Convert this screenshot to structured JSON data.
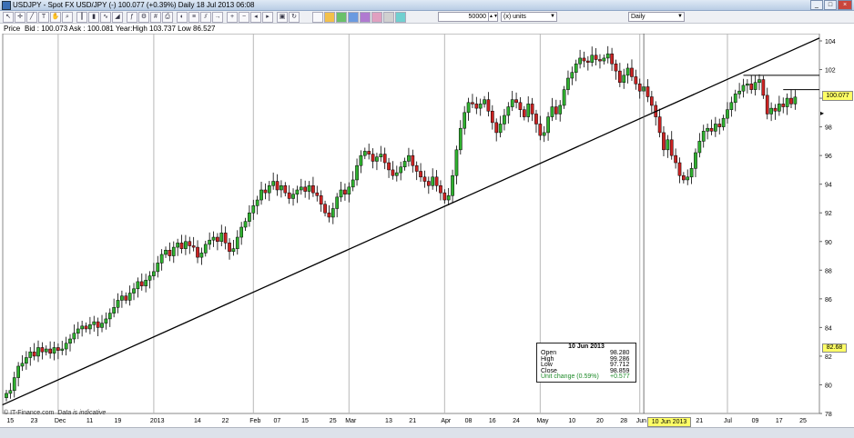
{
  "window": {
    "title": "USDJPY - Spot FX USD/JPY (-)   100.077 (+0.39%)   Daily   18 Jul 2013 06:08"
  },
  "toolbar": {
    "quantity": "50000",
    "units": "(x) units",
    "period": "Daily"
  },
  "infobar": {
    "label": "Price",
    "quote": "Bid : 100.073  Ask : 100.081  Year:High 103.737  Low 86.527"
  },
  "price_tag": "100.077",
  "price_tag2": "82.68",
  "cross_date": "10 Jun 2013",
  "credit": {
    "text": "© IT-Finance.com",
    "note": "Data is indicative"
  },
  "tooltip": {
    "date": "10 Jun 2013",
    "rows": [
      {
        "k": "Open",
        "v": "98.280"
      },
      {
        "k": "High",
        "v": "99.286"
      },
      {
        "k": "Low",
        "v": "97.712"
      },
      {
        "k": "Close",
        "v": "98.859"
      },
      {
        "k": "Unit change (0.59%)",
        "v": "+0.577"
      }
    ]
  },
  "colors": {
    "up": "#2fb12f",
    "down": "#cc2222",
    "grid": "#b8b8b8",
    "trend": "#000000"
  },
  "chart_data": {
    "type": "candlestick",
    "y_ticks": [
      78,
      80,
      82,
      84,
      86,
      88,
      90,
      92,
      94,
      96,
      98,
      100,
      102,
      104
    ],
    "ylim": [
      78,
      105
    ],
    "x_labels": [
      {
        "t": "15",
        "i": 1
      },
      {
        "t": "23",
        "i": 7
      },
      {
        "t": "Dec",
        "i": 13
      },
      {
        "t": "11",
        "i": 21
      },
      {
        "t": "19",
        "i": 28
      },
      {
        "t": "2013",
        "i": 37
      },
      {
        "t": "14",
        "i": 48
      },
      {
        "t": "22",
        "i": 55
      },
      {
        "t": "Feb",
        "i": 62
      },
      {
        "t": "07",
        "i": 68
      },
      {
        "t": "15",
        "i": 75
      },
      {
        "t": "25",
        "i": 82
      },
      {
        "t": "Mar",
        "i": 86
      },
      {
        "t": "13",
        "i": 96
      },
      {
        "t": "21",
        "i": 102
      },
      {
        "t": "Apr",
        "i": 110
      },
      {
        "t": "08",
        "i": 116
      },
      {
        "t": "16",
        "i": 122
      },
      {
        "t": "24",
        "i": 128
      },
      {
        "t": "May",
        "i": 134
      },
      {
        "t": "10",
        "i": 142
      },
      {
        "t": "20",
        "i": 149
      },
      {
        "t": "28",
        "i": 155
      },
      {
        "t": "Jun",
        "i": 159
      },
      {
        "t": "21",
        "i": 174
      },
      {
        "t": "Jul",
        "i": 181
      },
      {
        "t": "09",
        "i": 188
      },
      {
        "t": "17",
        "i": 194
      },
      {
        "t": "25",
        "i": 200
      }
    ],
    "month_lines": [
      13,
      37,
      62,
      86,
      110,
      134,
      159,
      181
    ],
    "closes": [
      79.4,
      79.6,
      80.5,
      81.3,
      81.5,
      81.9,
      82.3,
      82.0,
      82.6,
      82.3,
      82.5,
      82.2,
      82.6,
      82.4,
      82.5,
      82.9,
      83.2,
      83.6,
      83.9,
      84.1,
      83.9,
      84.2,
      84.4,
      84.0,
      84.3,
      84.6,
      85.0,
      85.4,
      85.9,
      86.2,
      85.9,
      86.4,
      86.7,
      87.2,
      86.9,
      87.3,
      87.6,
      87.9,
      88.5,
      89.1,
      89.4,
      89.0,
      89.6,
      89.9,
      89.5,
      90.0,
      89.7,
      89.6,
      88.9,
      89.2,
      89.8,
      90.1,
      90.3,
      90.0,
      90.6,
      89.9,
      89.3,
      89.5,
      90.3,
      91.0,
      91.4,
      92.0,
      92.5,
      92.9,
      93.6,
      93.4,
      93.9,
      94.2,
      93.6,
      93.9,
      93.4,
      93.0,
      93.3,
      93.6,
      93.8,
      93.5,
      93.9,
      93.4,
      93.2,
      92.6,
      92.0,
      91.7,
      92.3,
      93.1,
      93.6,
      93.3,
      93.8,
      94.3,
      95.3,
      96.0,
      96.3,
      96.1,
      95.6,
      95.9,
      96.1,
      95.5,
      95.0,
      94.6,
      94.8,
      95.2,
      95.6,
      96.0,
      95.3,
      94.9,
      94.5,
      94.2,
      93.9,
      94.5,
      93.9,
      93.4,
      92.9,
      93.2,
      94.6,
      96.4,
      97.9,
      99.0,
      99.7,
      99.6,
      99.3,
      99.6,
      99.9,
      99.1,
      98.3,
      97.6,
      98.2,
      98.8,
      99.4,
      99.9,
      99.7,
      99.2,
      98.7,
      99.6,
      98.9,
      98.2,
      97.4,
      97.6,
      98.7,
      99.4,
      98.9,
      99.5,
      100.6,
      101.4,
      101.8,
      102.4,
      102.8,
      102.6,
      102.5,
      103.0,
      102.7,
      102.6,
      102.8,
      103.1,
      102.4,
      101.9,
      101.1,
      101.6,
      102.1,
      101.5,
      101.0,
      100.5,
      100.8,
      100.1,
      99.5,
      98.7,
      97.6,
      96.4,
      97.1,
      96.0,
      95.5,
      94.6,
      94.3,
      94.5,
      95.1,
      96.2,
      97.0,
      97.7,
      97.9,
      97.7,
      98.2,
      98.0,
      98.6,
      99.2,
      99.7,
      100.3,
      100.5,
      100.9,
      101.0,
      100.6,
      101.1,
      101.3,
      100.2,
      98.9,
      99.3,
      99.1,
      99.6,
      99.4,
      100.0,
      99.6,
      100.08
    ]
  }
}
